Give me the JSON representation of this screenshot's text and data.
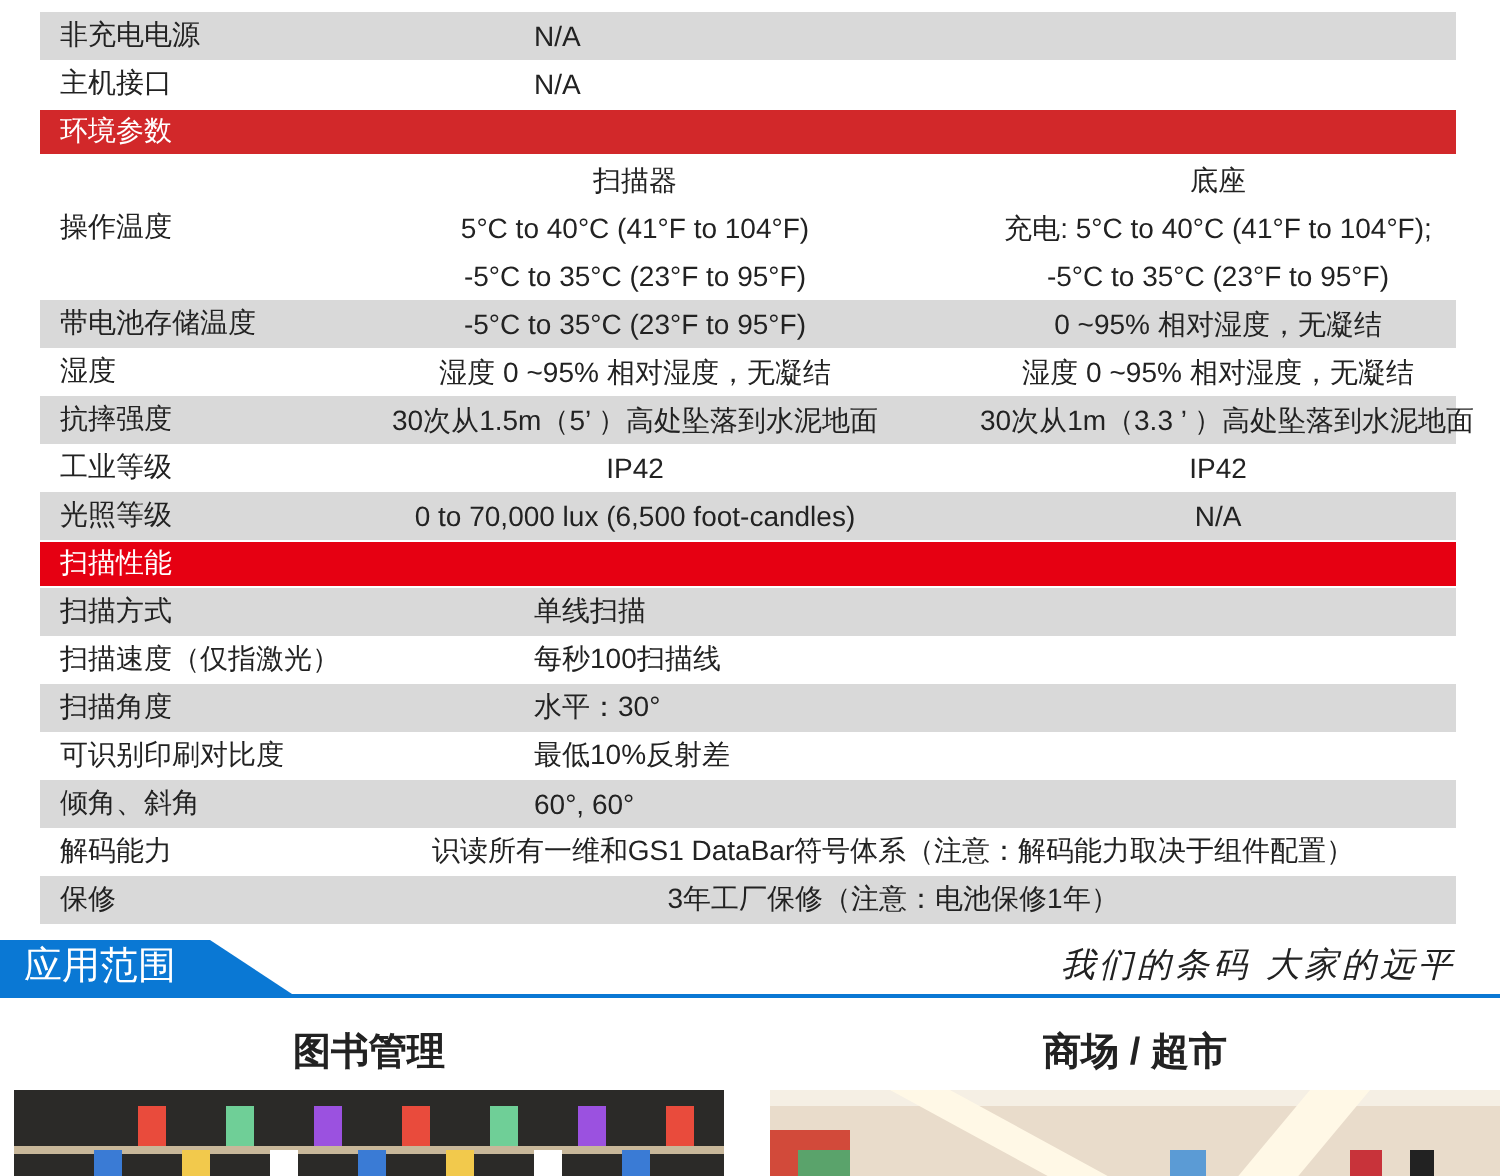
{
  "spec_table": {
    "rows": [
      {
        "kind": "left",
        "shaded": true,
        "label": "非充电电源",
        "value": "N/A"
      },
      {
        "kind": "left",
        "shaded": false,
        "label": "主机接口",
        "value": "N/A"
      },
      {
        "kind": "header",
        "color": "#d2282a",
        "label": "环境参数"
      },
      {
        "kind": "split",
        "shaded": false,
        "label": "操作温度",
        "columns": [
          [
            "扫描器",
            "5°C to 40°C (41°F to 104°F)",
            "-5°C to 35°C (23°F to 95°F)"
          ],
          [
            "底座",
            "充电: 5°C to 40°C (41°F to 104°F);",
            "-5°C to 35°C (23°F to 95°F)"
          ]
        ]
      },
      {
        "kind": "split",
        "shaded": true,
        "label": "带电池存储温度",
        "columns": [
          [
            "-5°C to 35°C (23°F to 95°F)"
          ],
          [
            "0 ~95% 相对湿度，无凝结"
          ]
        ]
      },
      {
        "kind": "split",
        "shaded": false,
        "label": "湿度",
        "columns": [
          [
            "湿度 0 ~95% 相对湿度，无凝结"
          ],
          [
            "湿度 0 ~95% 相对湿度，无凝结"
          ]
        ]
      },
      {
        "kind": "split",
        "shaded": true,
        "label": "抗摔强度",
        "columns": [
          [
            "30次从1.5m（5’ ）高处坠落到水泥地面"
          ],
          [
            "30次从1m（3.3 ’ ）高处坠落到水泥地面"
          ]
        ]
      },
      {
        "kind": "split",
        "shaded": false,
        "label": "工业等级",
        "columns": [
          [
            "IP42"
          ],
          [
            "IP42"
          ]
        ]
      },
      {
        "kind": "split",
        "shaded": true,
        "label": "光照等级",
        "columns": [
          [
            "0 to 70,000 lux (6,500 foot-candles)"
          ],
          [
            "N/A"
          ]
        ]
      },
      {
        "kind": "header",
        "color": "#e60012",
        "label": "扫描性能"
      },
      {
        "kind": "left",
        "shaded": true,
        "label": "扫描方式",
        "value": "单线扫描"
      },
      {
        "kind": "left",
        "shaded": false,
        "label": "扫描速度（仅指激光）",
        "value": "每秒100扫描线"
      },
      {
        "kind": "left",
        "shaded": true,
        "label": "扫描角度",
        "value": "水平：30°"
      },
      {
        "kind": "left",
        "shaded": false,
        "label": "可识别印刷对比度",
        "value": "最低10%反射差"
      },
      {
        "kind": "left",
        "shaded": true,
        "label": "倾角、斜角",
        "value": "60°, 60°"
      },
      {
        "kind": "span",
        "shaded": false,
        "label": "解码能力",
        "value": "识读所有一维和GS1 DataBar符号体系（注意：解码能力取决于组件配置）"
      },
      {
        "kind": "span",
        "shaded": true,
        "label": "保修",
        "value": "3年工厂保修（注意：电池保修1年）"
      }
    ]
  },
  "applications": {
    "title": "应用范围",
    "slogan": "我们的条码 大家的远平",
    "items": [
      {
        "title": "图书管理",
        "kind": "picture"
      },
      {
        "title": "商场 / 超市",
        "kind": "picture"
      }
    ]
  }
}
